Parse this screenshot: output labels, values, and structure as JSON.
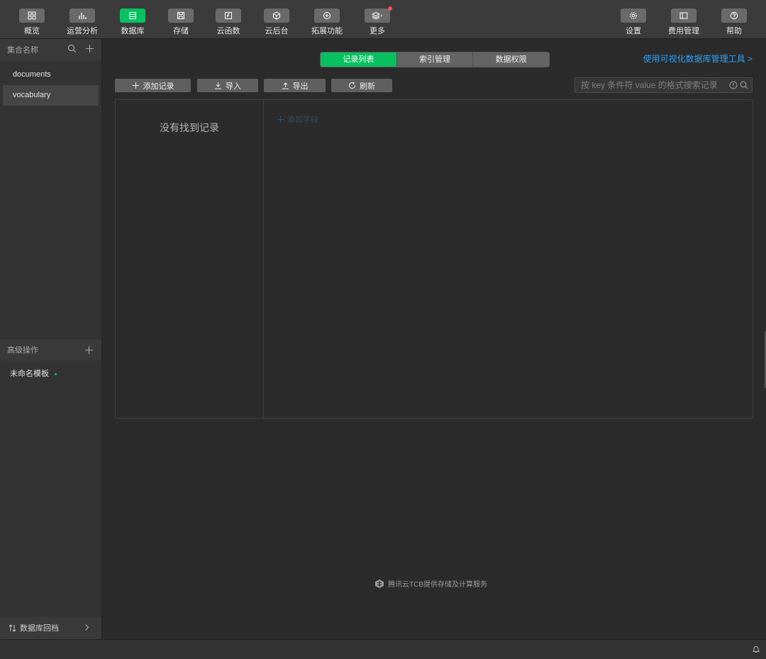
{
  "toolbar": {
    "left": [
      {
        "label": "概览",
        "icon": "overview-grid-icon"
      },
      {
        "label": "运营分析",
        "icon": "bar-chart-icon"
      },
      {
        "label": "数据库",
        "icon": "database-list-icon",
        "active": true
      },
      {
        "label": "存储",
        "icon": "storage-save-icon"
      },
      {
        "label": "云函数",
        "icon": "cloud-function-icon"
      },
      {
        "label": "云后台",
        "icon": "cube-icon"
      },
      {
        "label": "拓展功能",
        "icon": "extension-plus-icon"
      },
      {
        "label": "更多",
        "icon": "layers-dropdown-icon",
        "badge": true
      }
    ],
    "right": [
      {
        "label": "设置",
        "icon": "gear-icon"
      },
      {
        "label": "费用管理",
        "icon": "billing-icon"
      },
      {
        "label": "帮助",
        "icon": "help-question-icon"
      }
    ]
  },
  "sidebar": {
    "collections_header": "集合名称",
    "collections": [
      "documents",
      "vocabulary"
    ],
    "selected_collection": "vocabulary",
    "advanced_header": "高级操作",
    "template": "未命名模板",
    "rollback": "数据库回档"
  },
  "main": {
    "tabs": [
      "记录列表",
      "索引管理",
      "数据权限"
    ],
    "active_tab": "记录列表",
    "visual_tool_link": "使用可视化数据库管理工具 >",
    "buttons": {
      "add_record": "添加记录",
      "import": "导入",
      "export": "导出",
      "refresh": "刷新"
    },
    "search_placeholder": "按 key 条件符 value 的格式搜索记录",
    "empty_text": "没有找到记录",
    "add_field": "添加字段",
    "footer_note": "腾讯云TCB提供存储及计算服务"
  },
  "colors": {
    "accent_green": "#07c160",
    "link_blue": "#2f9ff7",
    "badge_red": "#fa5151"
  }
}
